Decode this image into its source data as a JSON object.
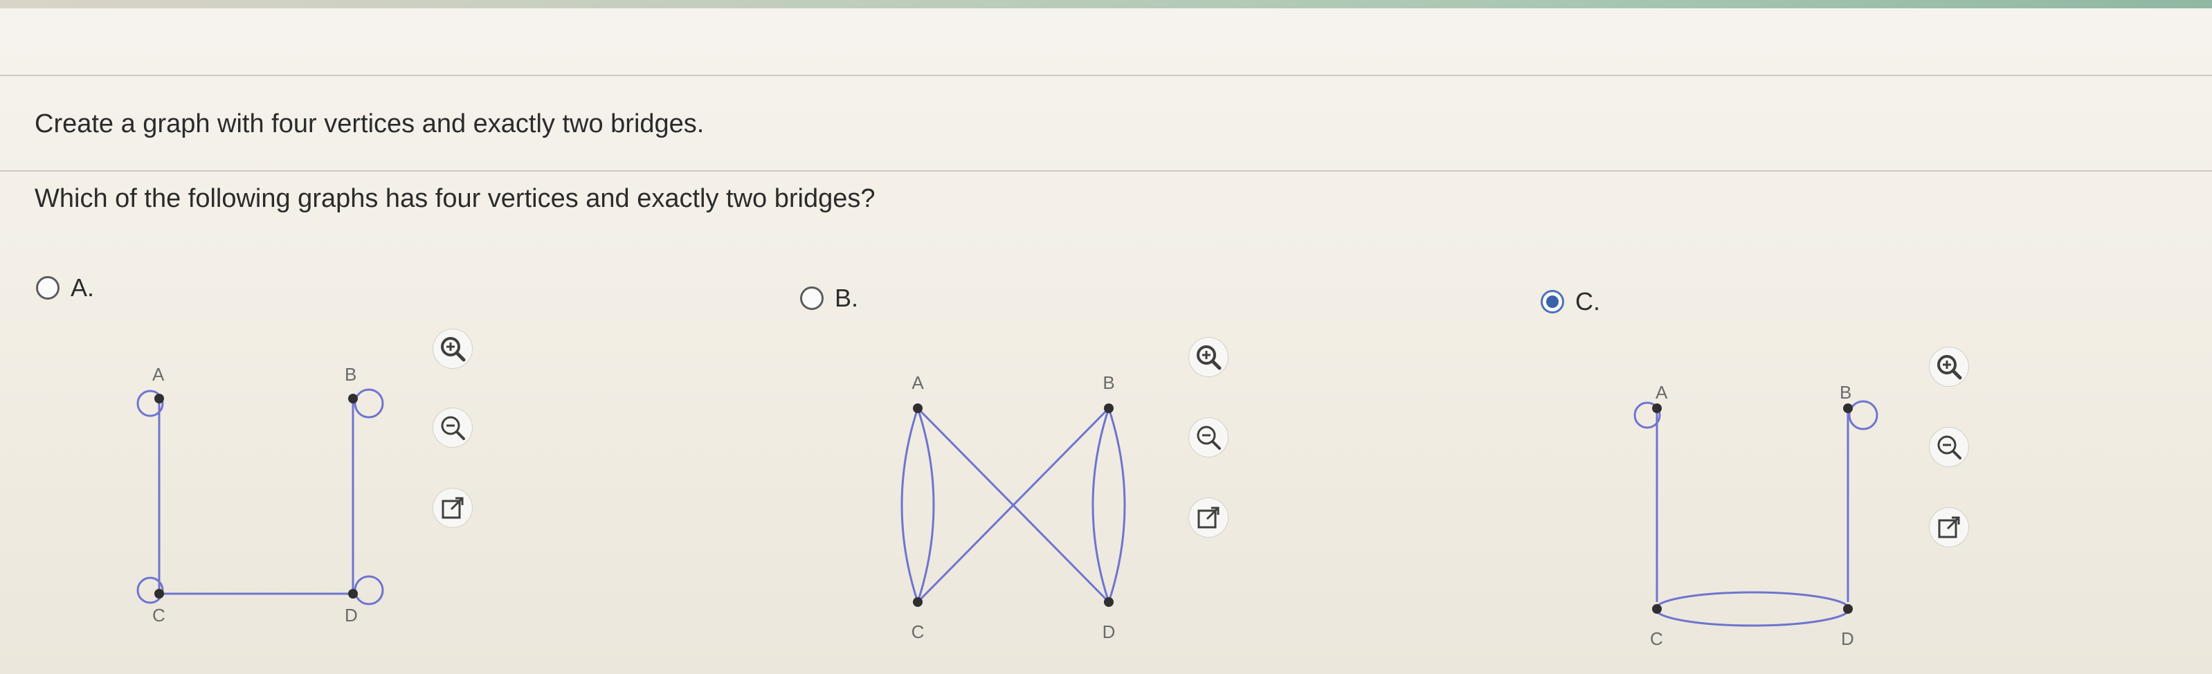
{
  "question": {
    "title": "Create a graph with four vertices and exactly two bridges.",
    "prompt": "Which of the following graphs has four vertices and exactly two bridges?"
  },
  "options": [
    {
      "label": "A.",
      "selected": false,
      "vertices": {
        "a": "A",
        "b": "B",
        "c": "C",
        "d": "D"
      }
    },
    {
      "label": "B.",
      "selected": false,
      "vertices": {
        "a": "A",
        "b": "B",
        "c": "C",
        "d": "D"
      }
    },
    {
      "label": "C.",
      "selected": true,
      "vertices": {
        "a": "A",
        "b": "B",
        "c": "C",
        "d": "D"
      }
    }
  ],
  "colors": {
    "edge": "#6f74cf",
    "vertex": "#2f2f2f",
    "label": "#6a6a6a",
    "zoom_icon": "#3f3f3f",
    "selected_radio": "#3b63a8"
  },
  "tools": [
    "zoom-in-icon",
    "zoom-out-icon",
    "popout-icon"
  ]
}
